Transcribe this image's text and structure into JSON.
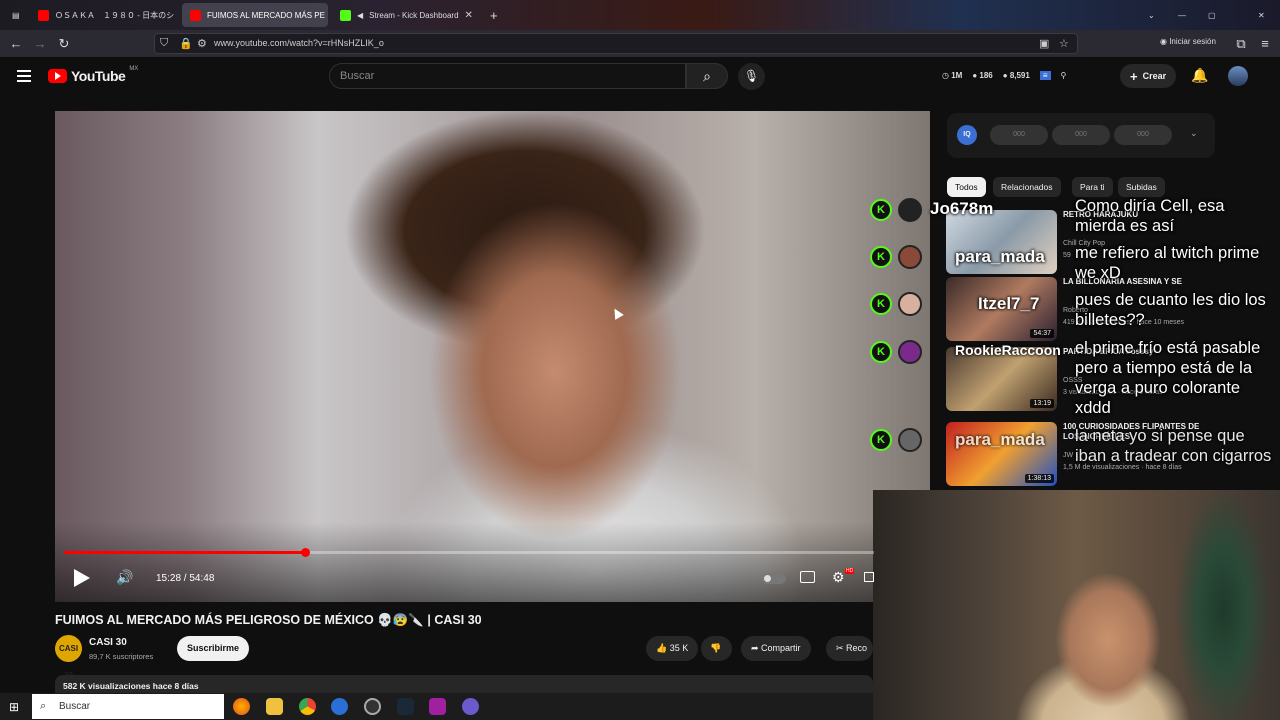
{
  "browser": {
    "tabs": [
      {
        "label": "ＯＳＡＫＡ　１９８０ - 日本のシ"
      },
      {
        "label": "FUIMOS AL MERCADO MÁS PE"
      },
      {
        "label": "Stream - Kick Dashboard"
      }
    ],
    "url": "www.youtube.com/watch?v=rHNsHZLIK_o",
    "signin": "Iniciar sesión"
  },
  "youtube": {
    "logo": "YouTube",
    "country": "MX",
    "search_placeholder": "Buscar",
    "stats": [
      "1M",
      "186",
      "8,591"
    ],
    "create": "Crear"
  },
  "player": {
    "time": "15:28 / 54:48",
    "progress": 0.298
  },
  "video": {
    "title": "FUIMOS AL MERCADO MÁS PELIGROSO DE MÉXICO 💀😰🔪 | CASI 30",
    "channel": "CASI 30",
    "channel_avatar": "CASI 30",
    "subs": "89,7 K suscriptores",
    "subscribe": "Suscribirme",
    "likes": "35 K",
    "share": "Compartir",
    "clip": "Reco",
    "meta": "582 K visualizaciones  hace 8 días"
  },
  "panel": {
    "ext_logo": "IQ",
    "chips": [
      "000",
      "000",
      "000"
    ],
    "tabs": [
      "Todos",
      "Relacionados",
      "Para ti",
      "Subidas"
    ]
  },
  "recommendations": [
    {
      "title": "RETRO HARAJUKU",
      "channel": "Chill City Pop",
      "meta": "59",
      "duration": ""
    },
    {
      "title": "LA BILLONARIA ASESINA Y SE",
      "channel": "Roberto",
      "meta": "419 K visualizaciones · hace 10 meses",
      "duration": "54:37"
    },
    {
      "title": "PARTIDA ÉPICA #osssy",
      "channel": "OSSS",
      "meta": "3 visualizaciones · hace 9 horas",
      "duration": "13:19"
    },
    {
      "title": "100 CURIOSIDADES FLIPANTES DE LOS INCREÍBLES",
      "channel": "JW",
      "meta": "1,5 M de visualizaciones · hace 8 días",
      "duration": "1:38:13"
    }
  ],
  "chat": [
    {
      "user": "Jo678m",
      "text": "Como diría Cell, esa mierda es así"
    },
    {
      "user": "para_mada",
      "text": "me refiero al twitch prime we xD"
    },
    {
      "user": "Itzel7_7",
      "text": "pues de cuanto les dio los billetes??"
    },
    {
      "user": "RookieRaccoon",
      "text": "el prime frío está pasable pero a tiempo está de la verga a puro colorante xddd"
    },
    {
      "user": "para_mada",
      "text": "la neta yo si pense que iban a tradear con cigarros"
    }
  ],
  "taskbar": {
    "search": "Buscar"
  },
  "colors": {
    "brand": "#ff0000",
    "kick": "#53fc18",
    "background": "#0f0f0f"
  }
}
